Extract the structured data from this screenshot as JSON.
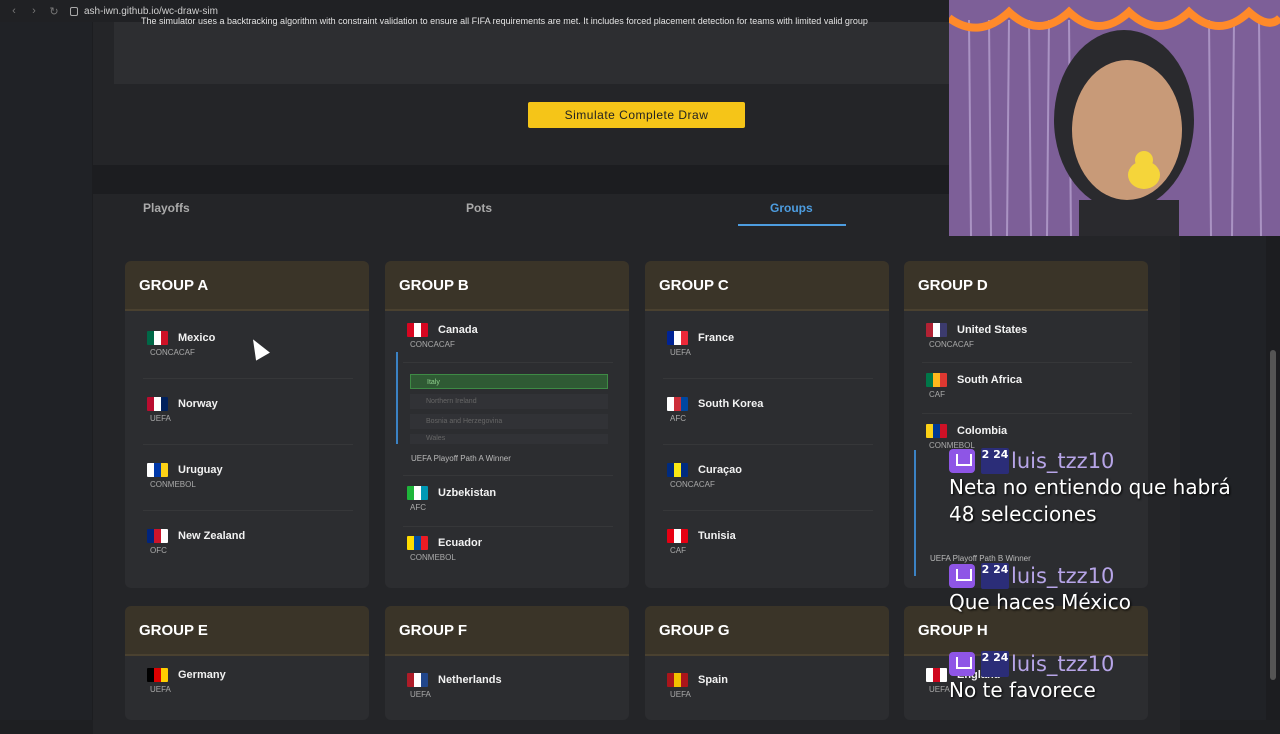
{
  "browser": {
    "url": "ash-iwn.github.io/wc-draw-sim"
  },
  "info": {
    "text": "The simulator uses a backtracking algorithm with constraint validation to ensure all FIFA requirements are met. It includes forced placement detection for teams with limited valid group"
  },
  "simulate_button": "Simulate Complete Draw",
  "tabs": [
    {
      "label": "Playoffs"
    },
    {
      "label": "Pots"
    },
    {
      "label": "Groups"
    }
  ],
  "groups": [
    {
      "title": "GROUP A",
      "teams": [
        {
          "name": "Mexico",
          "conf": "CONCACAF",
          "flag": [
            "#006847",
            "#ffffff",
            "#ce1126"
          ]
        },
        {
          "name": "Norway",
          "conf": "UEFA",
          "flag": [
            "#ba0c2f",
            "#ffffff",
            "#00205b"
          ]
        },
        {
          "name": "Uruguay",
          "conf": "CONMEBOL",
          "flag": [
            "#ffffff",
            "#0038a8",
            "#fcd116"
          ]
        },
        {
          "name": "New Zealand",
          "conf": "OFC",
          "flag": [
            "#00247d",
            "#cc142b",
            "#ffffff"
          ]
        }
      ]
    },
    {
      "title": "GROUP B",
      "teams": [
        {
          "name": "Canada",
          "conf": "CONCACAF",
          "flag": [
            "#d80621",
            "#ffffff",
            "#d80621"
          ]
        },
        {
          "name": "Uzbekistan",
          "conf": "AFC",
          "flag": [
            "#1eb53a",
            "#ffffff",
            "#0099b5"
          ]
        },
        {
          "name": "Ecuador",
          "conf": "CONMEBOL",
          "flag": [
            "#ffdd00",
            "#034ea2",
            "#ed1c24"
          ]
        }
      ],
      "playoff_label": "UEFA Playoff Path A Winner",
      "playoff_options": [
        "Italy",
        "Northern Ireland",
        "Bosnia and Herzegovina",
        "Wales"
      ]
    },
    {
      "title": "GROUP C",
      "teams": [
        {
          "name": "France",
          "conf": "UEFA",
          "flag": [
            "#002395",
            "#ffffff",
            "#ed2939"
          ]
        },
        {
          "name": "South Korea",
          "conf": "AFC",
          "flag": [
            "#ffffff",
            "#cd2e3a",
            "#0047a0"
          ]
        },
        {
          "name": "Curaçao",
          "conf": "CONCACAF",
          "flag": [
            "#002b7f",
            "#f9e814",
            "#002b7f"
          ]
        },
        {
          "name": "Tunisia",
          "conf": "CAF",
          "flag": [
            "#e70013",
            "#ffffff",
            "#e70013"
          ]
        }
      ]
    },
    {
      "title": "GROUP D",
      "teams": [
        {
          "name": "United States",
          "conf": "CONCACAF",
          "flag": [
            "#b22234",
            "#ffffff",
            "#3c3b6e"
          ]
        },
        {
          "name": "South Africa",
          "conf": "CAF",
          "flag": [
            "#007749",
            "#ffb81c",
            "#de3831"
          ]
        },
        {
          "name": "Colombia",
          "conf": "CONMEBOL",
          "flag": [
            "#fcd116",
            "#003893",
            "#ce1126"
          ]
        }
      ],
      "playoff_label": "UEFA Playoff Path B Winner"
    },
    {
      "title": "GROUP E",
      "teams": [
        {
          "name": "Germany",
          "conf": "UEFA",
          "flag": [
            "#000000",
            "#dd0000",
            "#ffce00"
          ]
        }
      ]
    },
    {
      "title": "GROUP F",
      "teams": [
        {
          "name": "Netherlands",
          "conf": "UEFA",
          "flag": [
            "#ae1c28",
            "#ffffff",
            "#21468b"
          ]
        }
      ]
    },
    {
      "title": "GROUP G",
      "teams": [
        {
          "name": "Spain",
          "conf": "UEFA",
          "flag": [
            "#aa151b",
            "#f1bf00",
            "#aa151b"
          ]
        }
      ]
    },
    {
      "title": "GROUP H",
      "teams": [
        {
          "name": "England",
          "conf": "UEFA",
          "flag": [
            "#ffffff",
            "#cf081f",
            "#ffffff"
          ]
        }
      ]
    }
  ],
  "chat": [
    {
      "user": "luis_tzz10",
      "badge": "2 24",
      "message_lines": [
        "Neta no entiendo que habrá",
        "48 selecciones"
      ]
    },
    {
      "user": "luis_tzz10",
      "badge": "2 24",
      "message_lines": [
        "Que haces México"
      ]
    },
    {
      "user": "luis_tzz10",
      "badge": "2 24",
      "message_lines": [
        "No te favorece"
      ]
    }
  ]
}
